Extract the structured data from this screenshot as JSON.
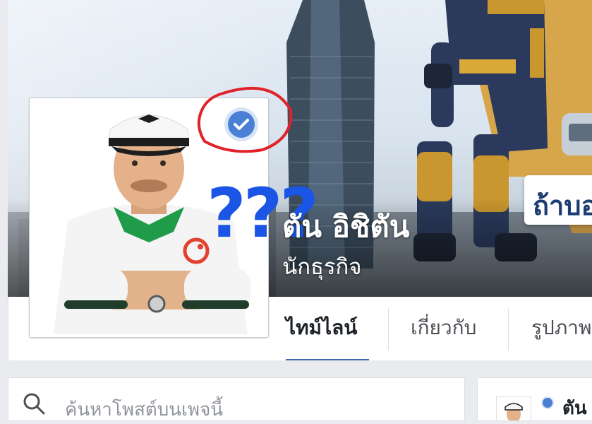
{
  "profile": {
    "name": "ตัน อิชิตัน",
    "subtitle": "นักธุรกิจ",
    "verified": true,
    "annotation_text": "???",
    "cover_banner_text": "ถ้าบอ"
  },
  "tabs": [
    {
      "label": "ไทม์ไลน์",
      "active": true
    },
    {
      "label": "เกี่ยวกับ",
      "active": false
    },
    {
      "label": "รูปภาพ",
      "active": false
    }
  ],
  "search": {
    "placeholder": "ค้นหาโพสต์บนเพจนี้"
  },
  "side_card": {
    "name": "ตัน"
  },
  "colors": {
    "verified_badge": "#4a7fd6",
    "annotation_red": "#e0222a",
    "question_blue": "#1a55e6",
    "active_tab_underline": "#4267b2"
  }
}
